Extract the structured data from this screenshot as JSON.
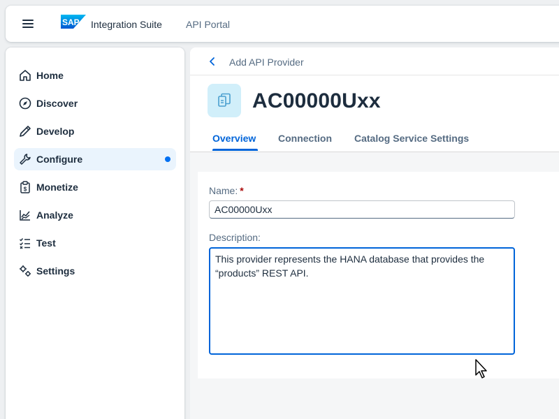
{
  "shell": {
    "logo_text": "SAP",
    "product_name": "Integration Suite",
    "secondary_title": "API Portal"
  },
  "sidebar": {
    "items": [
      {
        "label": "Home",
        "icon": "home-icon"
      },
      {
        "label": "Discover",
        "icon": "compass-icon"
      },
      {
        "label": "Develop",
        "icon": "pencil-icon"
      },
      {
        "label": "Configure",
        "icon": "wrench-icon",
        "active": true
      },
      {
        "label": "Monetize",
        "icon": "clipboard-dollar-icon"
      },
      {
        "label": "Analyze",
        "icon": "area-chart-icon"
      },
      {
        "label": "Test",
        "icon": "checklist-icon"
      },
      {
        "label": "Settings",
        "icon": "gears-icon"
      }
    ]
  },
  "header": {
    "breadcrumb": "Add API Provider",
    "title": "AC00000Uxx",
    "tabs": [
      {
        "label": "Overview",
        "selected": true
      },
      {
        "label": "Connection"
      },
      {
        "label": "Catalog Service Settings"
      }
    ]
  },
  "form": {
    "name_label": "Name:",
    "required_mark": "*",
    "name_value": "AC00000Uxx",
    "description_label": "Description:",
    "description_value": "This provider represents the HANA database that provides the “products” REST API."
  },
  "colors": {
    "accent": "#0064d9",
    "active_nav_bg": "#eaf4fd",
    "avatar_bg": "#d1effa",
    "sap_blue": "#0a6ed1"
  }
}
